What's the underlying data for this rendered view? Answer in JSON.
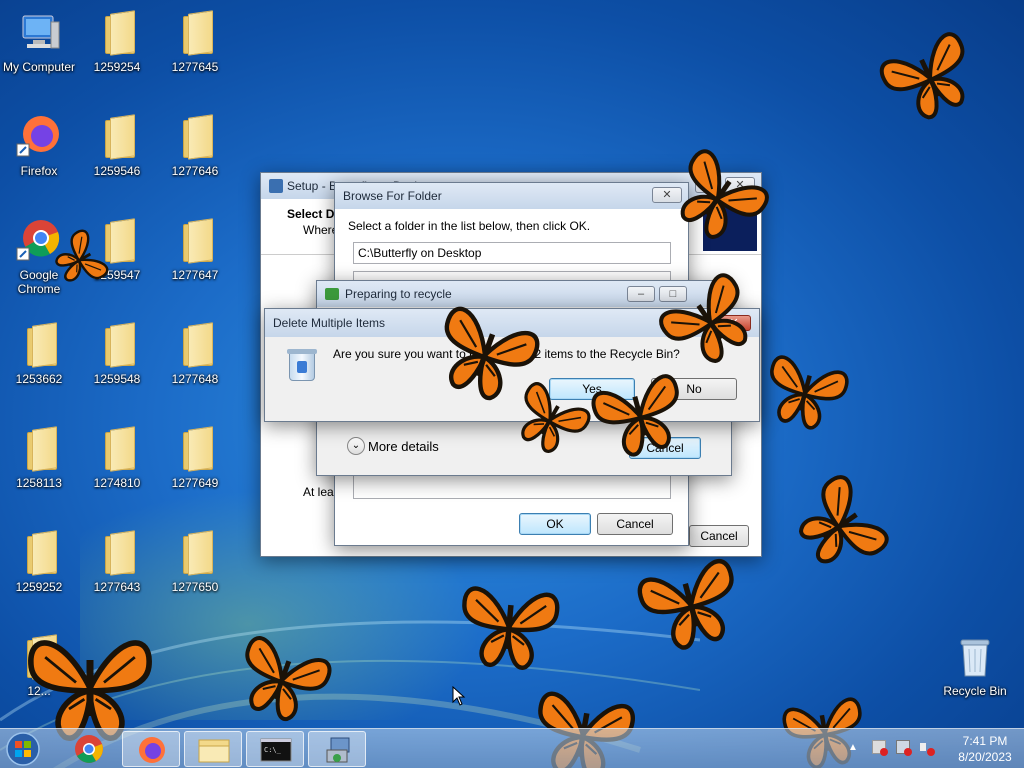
{
  "desktop": {
    "icons": [
      {
        "label": "My Computer",
        "type": "computer"
      },
      {
        "label": "1259254",
        "type": "folder"
      },
      {
        "label": "1277645",
        "type": "folder"
      },
      {
        "label": "Firefox",
        "type": "firefox"
      },
      {
        "label": "1259546",
        "type": "folder"
      },
      {
        "label": "1277646",
        "type": "folder"
      },
      {
        "label": "Google Chrome",
        "type": "chrome"
      },
      {
        "label": "1259547",
        "type": "folder"
      },
      {
        "label": "1277647",
        "type": "folder"
      },
      {
        "label": "1253662",
        "type": "folder"
      },
      {
        "label": "1259548",
        "type": "folder"
      },
      {
        "label": "1277648",
        "type": "folder"
      },
      {
        "label": "1258113",
        "type": "folder"
      },
      {
        "label": "1274810",
        "type": "folder"
      },
      {
        "label": "1277649",
        "type": "folder"
      },
      {
        "label": "1259252",
        "type": "folder"
      },
      {
        "label": "1277643",
        "type": "folder"
      },
      {
        "label": "1277650",
        "type": "folder"
      },
      {
        "label": "12...",
        "type": "folder"
      },
      {
        "label": "Recycle Bin",
        "type": "recycle"
      }
    ]
  },
  "setup_window": {
    "title": "Setup - Butterfly on Desktop",
    "heading": "Select D",
    "subheading": "Where",
    "footnote": "At leas",
    "cancel_label": "Cancel"
  },
  "browse_dialog": {
    "title": "Browse For Folder",
    "instruction": "Select a folder in the list below, then click OK.",
    "path_value": "C:\\Butterfly on Desktop",
    "ok_label": "OK",
    "cancel_label": "Cancel"
  },
  "recycle_progress": {
    "title": "Preparing to recycle",
    "more_details_label": "More details",
    "cancel_label": "Cancel"
  },
  "delete_dialog": {
    "title": "Delete Multiple Items",
    "message": "Are you sure you want to move these 2 items to the Recycle Bin?",
    "yes_label": "Yes",
    "no_label": "No"
  },
  "taskbar": {
    "items": [
      "start-orb",
      "chrome",
      "firefox",
      "file-explorer",
      "command-prompt",
      "setup-installer"
    ],
    "clock_time": "7:41 PM",
    "clock_date": "8/20/2023"
  },
  "colors": {
    "butterfly_orange": "#f07a12",
    "butterfly_black": "#1a1208",
    "window_title_bg": "#c6d6ea",
    "close_red": "#c6452f"
  }
}
